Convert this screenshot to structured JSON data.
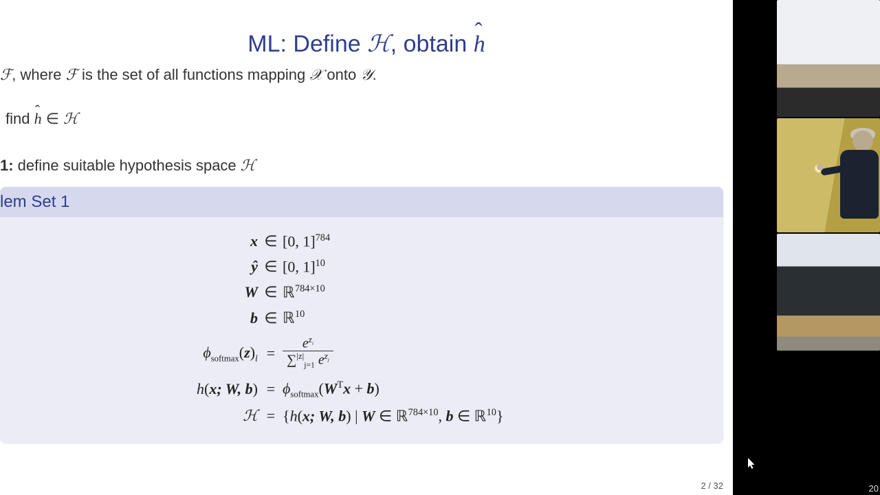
{
  "slide": {
    "title_prefix": "ML: Define ",
    "title_H": "ℋ",
    "title_mid": ", obtain ",
    "title_hhat": "h",
    "line1_pre": ", where ",
    "line1_mid": " is the set of all functions mapping ",
    "line1_onto": " onto ",
    "line1_end": ".",
    "sym_F": "ℱ",
    "sym_X": "𝒳",
    "sym_Y": "𝒴",
    "line2_pre": " find ",
    "line2_in": " ∈ ",
    "line2_H": "ℋ",
    "line3_label": "1:",
    "line3_text": " define suitable hypothesis space ",
    "line3_H": "ℋ",
    "example_title": "lem Set 1",
    "pagenum": "2 / 32"
  },
  "eq": {
    "r1": {
      "lhs_sym": "x",
      "rel": "∈",
      "rhs_a": "[0, 1]",
      "rhs_sup": "784"
    },
    "r2": {
      "lhs_sym": "ŷ",
      "rel": "∈",
      "rhs_a": "[0, 1]",
      "rhs_sup": "10"
    },
    "r3": {
      "lhs_sym": "W",
      "rel": "∈",
      "rhs_bb": "ℝ",
      "rhs_sup": "784×10"
    },
    "r4": {
      "lhs_sym": "b",
      "rel": "∈",
      "rhs_bb": "ℝ",
      "rhs_sup": "10"
    },
    "r5": {
      "lhs_phi": "ϕ",
      "lhs_sub": "softmax",
      "lhs_arg": "z",
      "lhs_i": "i",
      "rel": "=",
      "num_e": "e",
      "num_sup": "z",
      "num_sup_i": "i",
      "den_sum": "∑",
      "den_lo_pre": "j=1",
      "den_hi": "|z|",
      "den_e": "e",
      "den_sup": "z",
      "den_sup_j": "j"
    },
    "r6": {
      "lhs_h": "h",
      "lhs_args": "x; W, b",
      "rel": "=",
      "rhs_phi": "ϕ",
      "rhs_sub": "softmax",
      "rhs_inner_pre": "W",
      "rhs_T": "T",
      "rhs_x": "x",
      "rhs_plus": " + ",
      "rhs_b": "b"
    },
    "r7": {
      "lhs_H": "ℋ",
      "rel": "=",
      "open": "{",
      "h": "h",
      "args": "x; W, b",
      "bar": " | ",
      "W": "W",
      "in1": " ∈ ",
      "R1": "ℝ",
      "sup1": "784×10",
      "comma": ", ",
      "b": "b",
      "in2": " ∈ ",
      "R2": "ℝ",
      "sup2": "10",
      "close": "}"
    }
  },
  "video": {
    "timecode_partial": "20"
  }
}
